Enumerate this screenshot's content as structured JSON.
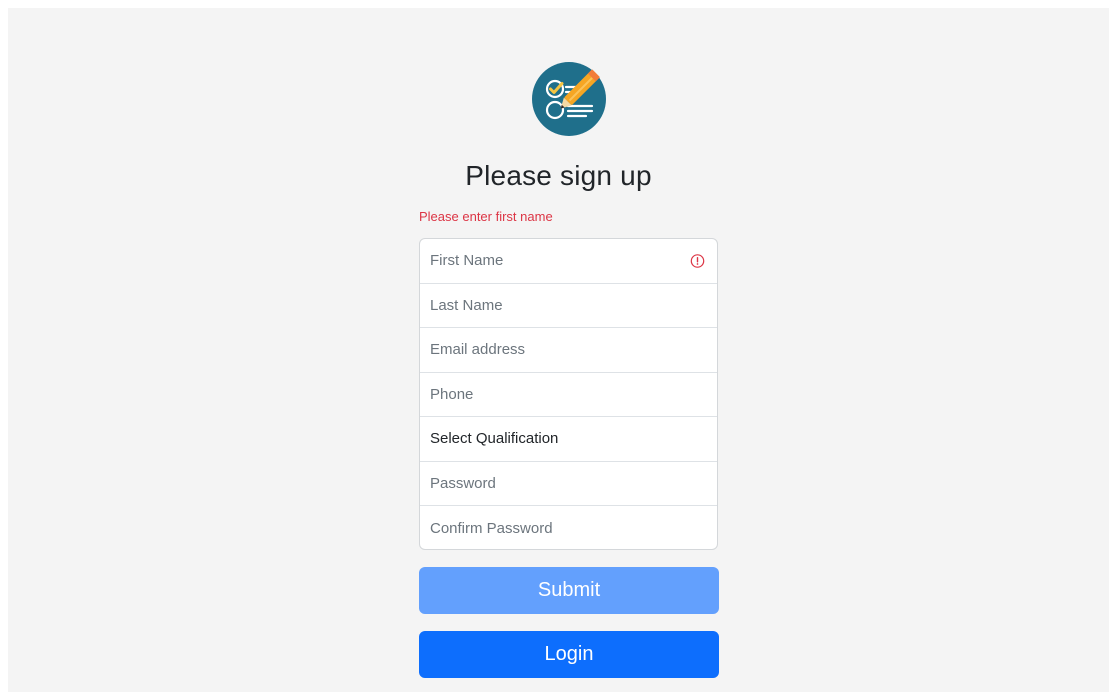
{
  "logo": {
    "icon": "signup-form-logo-icon",
    "colors": {
      "circle": "#1f6f8b",
      "check": "#f5c542",
      "pencil": "#f6a623"
    }
  },
  "form": {
    "title": "Please sign up",
    "error": "Please enter first name",
    "fields": {
      "first_name": {
        "placeholder": "First Name",
        "invalid": true
      },
      "last_name": {
        "placeholder": "Last Name"
      },
      "email": {
        "placeholder": "Email address"
      },
      "phone": {
        "placeholder": "Phone"
      },
      "qualification": {
        "label": "Select Qualification"
      },
      "password": {
        "placeholder": "Password"
      },
      "confirm_password": {
        "placeholder": "Confirm Password"
      }
    },
    "submit_label": "Submit",
    "login_label": "Login"
  },
  "colors": {
    "page_bg": "#f4f4f4",
    "error": "#dc3545",
    "submit_disabled": "#63a0fd",
    "primary": "#0d6efd"
  }
}
